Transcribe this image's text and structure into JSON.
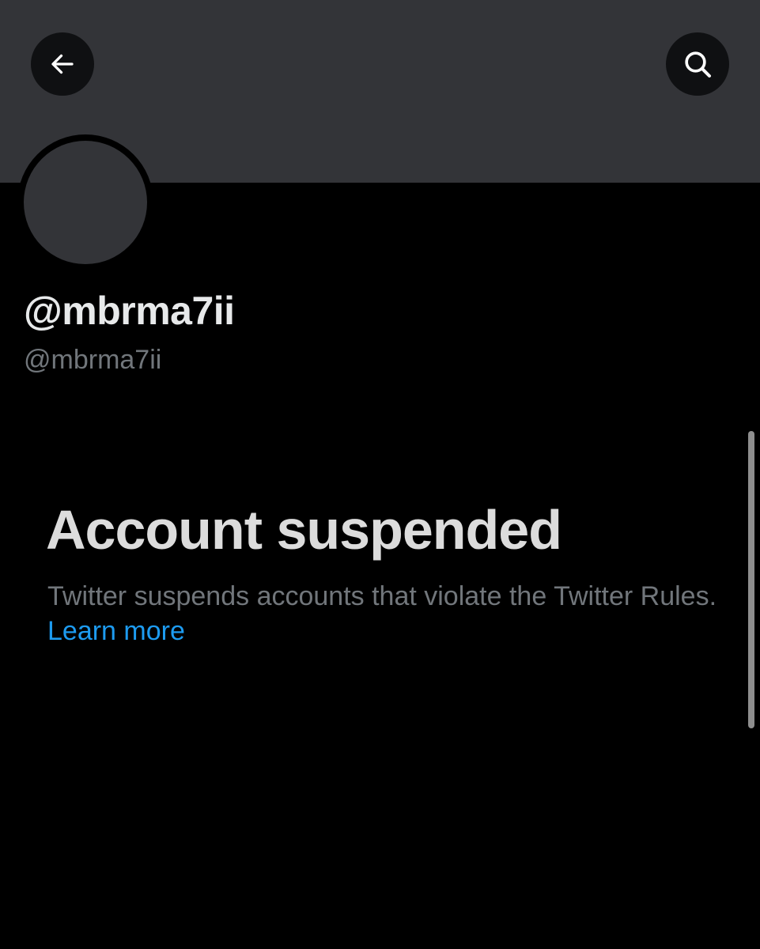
{
  "header": {
    "back_icon": "arrow-left-icon",
    "search_icon": "search-icon"
  },
  "profile": {
    "display_name": "@mbrma7ii",
    "handle": "@mbrma7ii"
  },
  "suspension": {
    "title": "Account suspended",
    "description": "Twitter suspends accounts that violate the Twitter Rules.",
    "learn_more": "Learn more"
  },
  "colors": {
    "background": "#000000",
    "banner": "#333438",
    "link": "#1d9bf0",
    "secondary_text": "#71767b"
  }
}
